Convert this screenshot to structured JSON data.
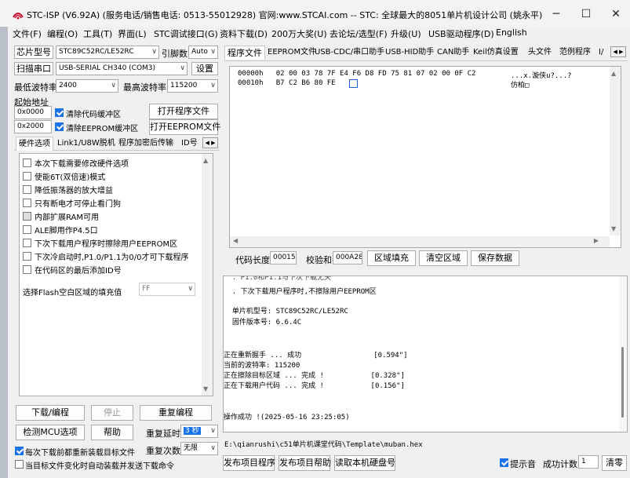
{
  "window": {
    "title": "STC-ISP (V6.92A) (服务电话/销售电话: 0513-55012928) 官网:www.STCAI.com  -- STC: 全球最大的8051单片机设计公司 (姚永平)",
    "minimize": "─",
    "maximize": "☐",
    "close": "✕"
  },
  "menu": [
    "文件(F)",
    "编程(O)",
    "工具(T)",
    "界面(L)",
    "STC调试接口(G)",
    "资料下载(D)",
    "200万大奖(U)",
    "去论坛/选型(F)",
    "升级(U)",
    "USB驱动程序(D)",
    "English"
  ],
  "left": {
    "chip_label": "芯片型号",
    "chip_value": "STC89C52RC/LE52RC",
    "pins_label": "引脚数",
    "pins_value": "Auto",
    "scan_button": "扫描串口",
    "port_value": "USB-SERIAL CH340 (COM3)",
    "settings_button": "设置",
    "min_baud_label": "最低波特率",
    "min_baud_value": "2400",
    "max_baud_label": "最高波特率",
    "max_baud_value": "115200",
    "start_addr_label": "起始地址",
    "addr1_value": "0x0000",
    "clear_code_label": "清除代码缓冲区",
    "open_prog_button": "打开程序文件",
    "addr2_value": "0x2000",
    "clear_eeprom_label": "清除EEPROM缓冲区",
    "open_eeprom_button": "打开EEPROM文件",
    "tabs": [
      "硬件选项",
      "Link1/U8W脱机",
      "程序加密后传输",
      "ID号"
    ],
    "tab_scroll": "◀ ▶",
    "options": [
      {
        "label": "本次下载需要修改硬件选项",
        "checked": false
      },
      {
        "label": "使能6T(双倍速)模式",
        "checked": false
      },
      {
        "label": "降低振荡器的放大增益",
        "checked": false
      },
      {
        "label": "只有断电才可停止看门狗",
        "checked": false
      },
      {
        "label": "内部扩展RAM可用",
        "checked": false
      },
      {
        "label": "ALE脚用作P4.5口",
        "checked": false
      },
      {
        "label": "下次下载用户程序时擦除用户EEPROM区",
        "checked": false
      },
      {
        "label": "下次冷启动时,P1.0/P1.1为0/0才可下载程序",
        "checked": false
      },
      {
        "label": "在代码区的最后添加ID号",
        "checked": false
      }
    ],
    "fill_label": "选择Flash空白区域的填充值",
    "fill_value": "FF",
    "download_button": "下载/编程",
    "stop_button": "停止",
    "reprogram_button": "重复编程",
    "detect_button": "检测MCU选项",
    "help_button": "帮助",
    "repeat_delay_label": "重复延时",
    "repeat_delay_value": "3 秒",
    "reload_label": "每次下载前都重新装载目标文件",
    "repeat_count_label": "重复次数",
    "repeat_count_value": "无限",
    "auto_send_label": "当目标文件变化时自动装载并发送下载命令"
  },
  "right": {
    "tabs": [
      "程序文件",
      "EEPROM文件",
      "USB-CDC/串口助手",
      "USB-HID助手",
      "CAN助手",
      "Keil仿真设置",
      "头文件",
      "范例程序",
      "I/"
    ],
    "tab_scroll": "◀ ▶",
    "hex_lines": [
      "00000h   02 00 03 78 7F E4 F6 D8 FD 75 81 07 02 00 0F C2",
      "00010h   B7 C2 B6 80 FE"
    ],
    "ascii_lines": [
      "...x.漩侠u?...?",
      "仿柏□"
    ],
    "code_len_label": "代码长度",
    "code_len_value": "00015",
    "checksum_label": "校验和",
    "checksum_value": "000A28",
    "fill_area_button": "区域填充",
    "clear_area_button": "清空区域",
    "save_data_button": "保存数据",
    "log_lines": [
      "  . 下次下载用户程序时,不擦除用户EEPROM区",
      "",
      "  单片机型号: STC89C52RC/LE52RC",
      "  固件版本号: 6.6.4C",
      "",
      "",
      "正在重新握手 ... 成功                 [0.594\"]",
      "当前的波特率: 115200",
      "正在擦除目标区域 ... 完成 !           [0.328\"]",
      "正在下载用户代码 ... 完成 !           [0.156\"]",
      "",
      "",
      "",
      "操作成功 !(2025-05-16 23:25:05)"
    ],
    "log_top_partial": "  . P1.0和P1.1与下次下载无关",
    "file_path": "E:\\qianrushi\\c51单片机课堂代码\\Template\\muban.hex",
    "publish_prog_button": "发布项目程序",
    "publish_help_button": "发布项目帮助",
    "read_disk_button": "读取本机硬盘号",
    "beep_label": "提示音",
    "success_count_label": "成功计数",
    "success_count_value": "1",
    "clear_button": "清零"
  }
}
